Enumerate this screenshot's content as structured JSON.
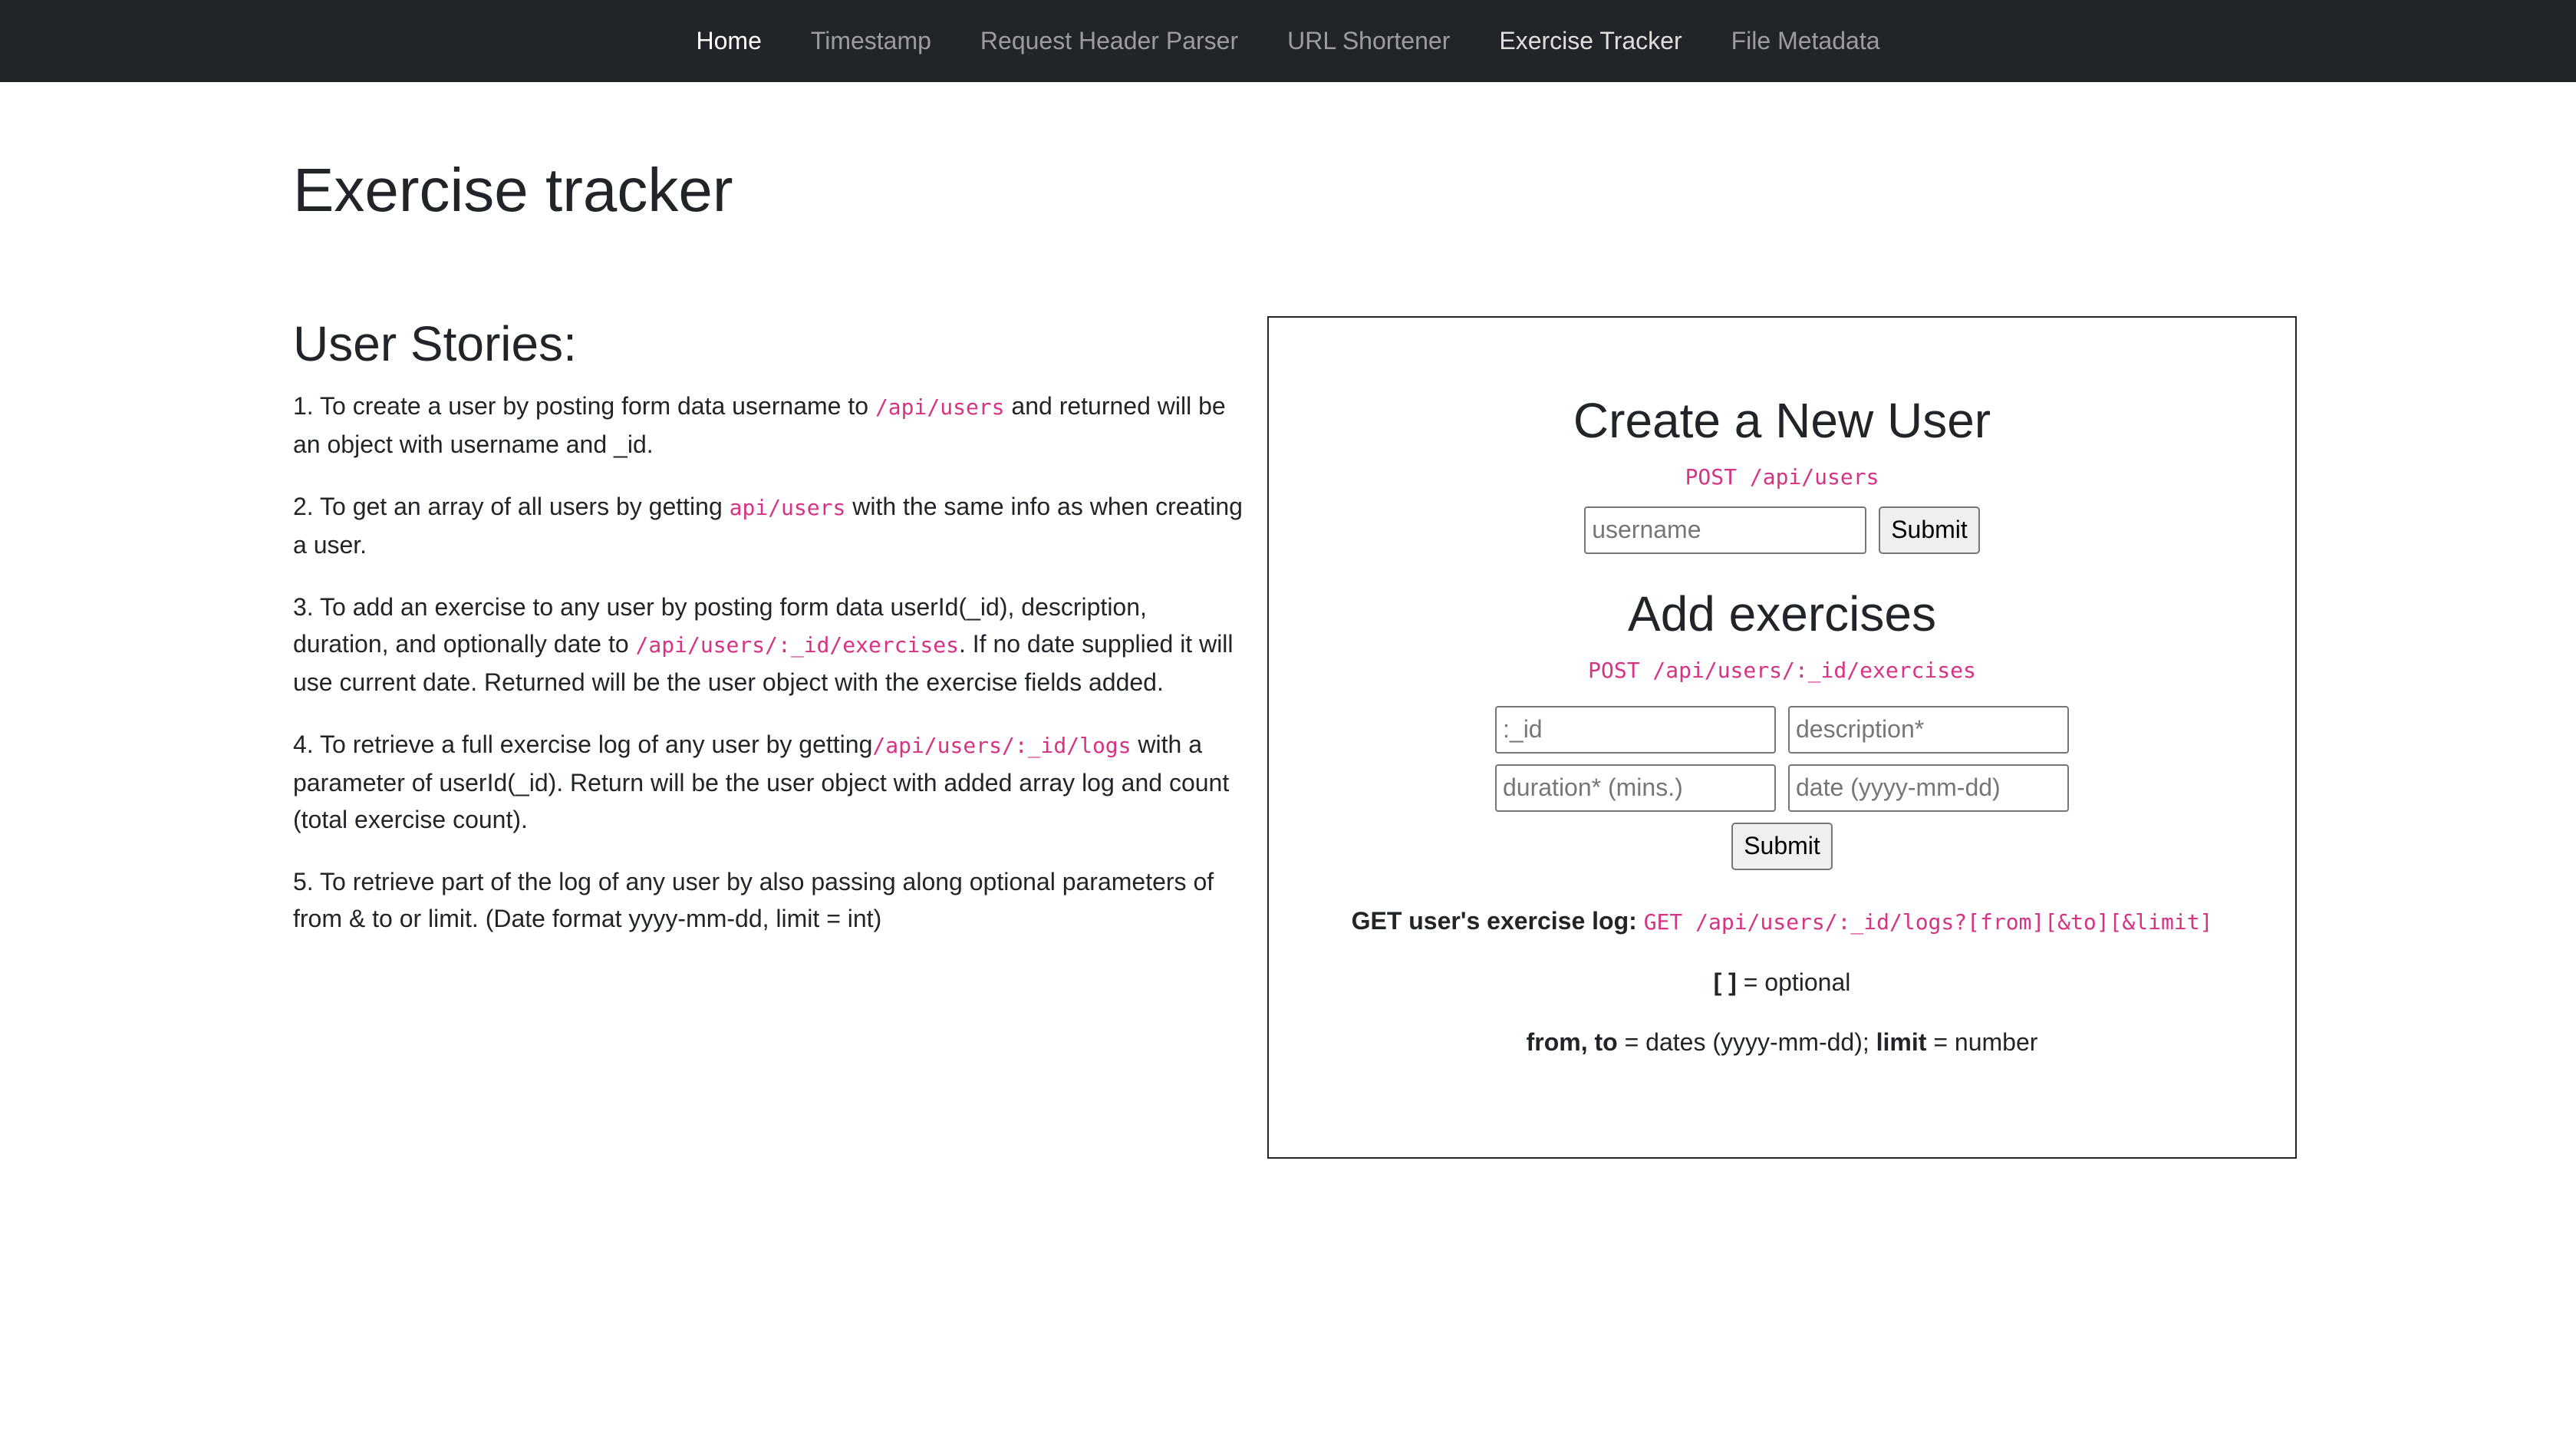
{
  "nav": {
    "items": [
      {
        "label": "Home"
      },
      {
        "label": "Timestamp"
      },
      {
        "label": "Request Header Parser"
      },
      {
        "label": "URL Shortener"
      },
      {
        "label": "Exercise Tracker"
      },
      {
        "label": "File Metadata"
      }
    ]
  },
  "page": {
    "title": "Exercise tracker"
  },
  "stories": {
    "heading": "User Stories:",
    "items": [
      {
        "pre": "1. To create a user by posting form data username to ",
        "code": "/api/users",
        "post": " and returned will be an object with username and _id."
      },
      {
        "pre": "2. To get an array of all users by getting ",
        "code": "api/users",
        "post": " with the same info as when creating a user."
      },
      {
        "pre": "3. To add an exercise to any user by posting form data userId(_id), description, duration, and optionally date to ",
        "code": "/api/users/:_id/exercises",
        "post": ". If no date supplied it will use current date. Returned will be the user object with the exercise fields added."
      },
      {
        "pre": "4. To retrieve a full exercise log of any user by getting",
        "code": "/api/users/:_id/logs",
        "post": " with a parameter of userId(_id). Return will be the user object with added array log and count (total exercise count)."
      },
      {
        "pre": "5. To retrieve part of the log of any user by also passing along optional parameters of from & to or limit. (Date format yyyy-mm-dd, limit = int)",
        "code": "",
        "post": ""
      }
    ]
  },
  "create_user": {
    "heading": "Create a New User",
    "endpoint": "POST /api/users",
    "username_placeholder": "username",
    "submit_label": "Submit"
  },
  "add_exercise": {
    "heading": "Add exercises",
    "endpoint": "POST /api/users/:_id/exercises",
    "id_placeholder": ":_id",
    "description_placeholder": "description*",
    "duration_placeholder": "duration* (mins.)",
    "date_placeholder": "date (yyyy-mm-dd)",
    "submit_label": "Submit"
  },
  "log_info": {
    "label": "GET user's exercise log:",
    "endpoint": "GET /api/users/:_id/logs?[from][&to][&limit]",
    "optional_brackets": "[ ]",
    "optional_text": " = optional",
    "params_bold1": "from, to",
    "params_text1": " = dates (yyyy-mm-dd); ",
    "params_bold2": "limit",
    "params_text2": " = number"
  },
  "colors": {
    "navbar_bg": "#212529",
    "code": "#d63384"
  }
}
